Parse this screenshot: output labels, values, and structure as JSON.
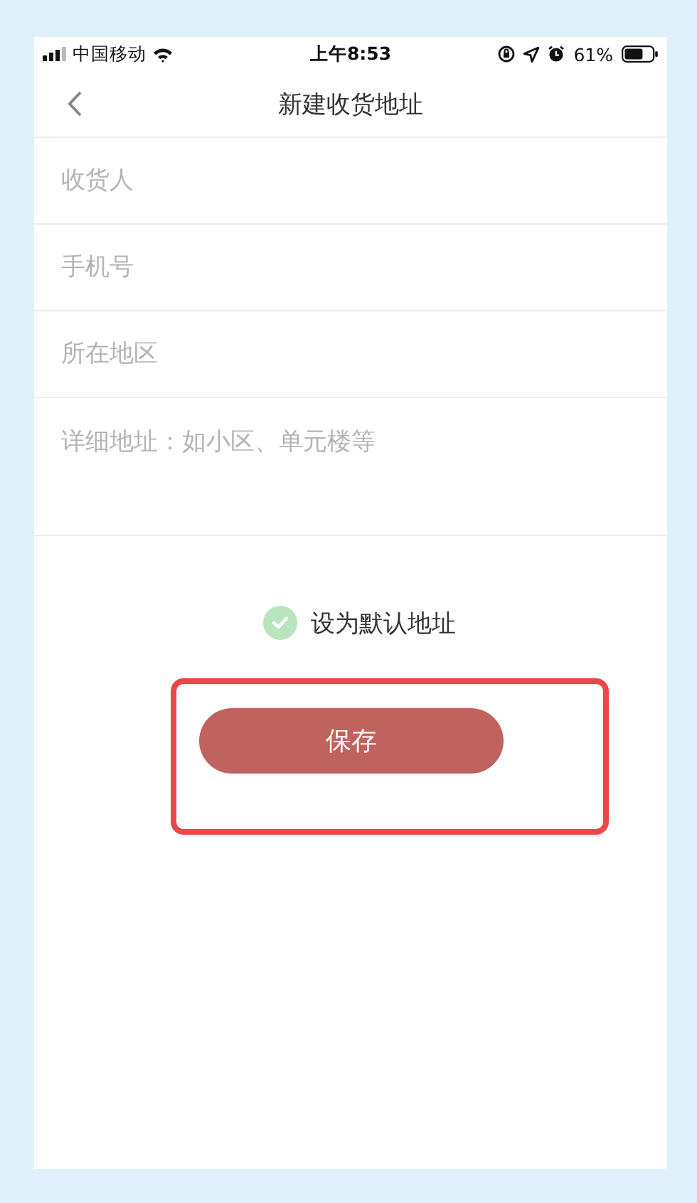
{
  "status_bar": {
    "carrier": "中国移动",
    "time": "上午8:53",
    "battery": "61%"
  },
  "nav_bar": {
    "title": "新建收货地址"
  },
  "fields": [
    {
      "kind": "line",
      "placeholder": "收货人"
    },
    {
      "kind": "line",
      "placeholder": "手机号"
    },
    {
      "kind": "line",
      "placeholder": "所在地区"
    },
    {
      "kind": "area",
      "placeholder": "详细地址：如小区、单元楼等"
    }
  ],
  "default_address": {
    "label": "设为默认地址",
    "checked": true
  },
  "save_button": {
    "label": "保存",
    "highlighted": true
  }
}
